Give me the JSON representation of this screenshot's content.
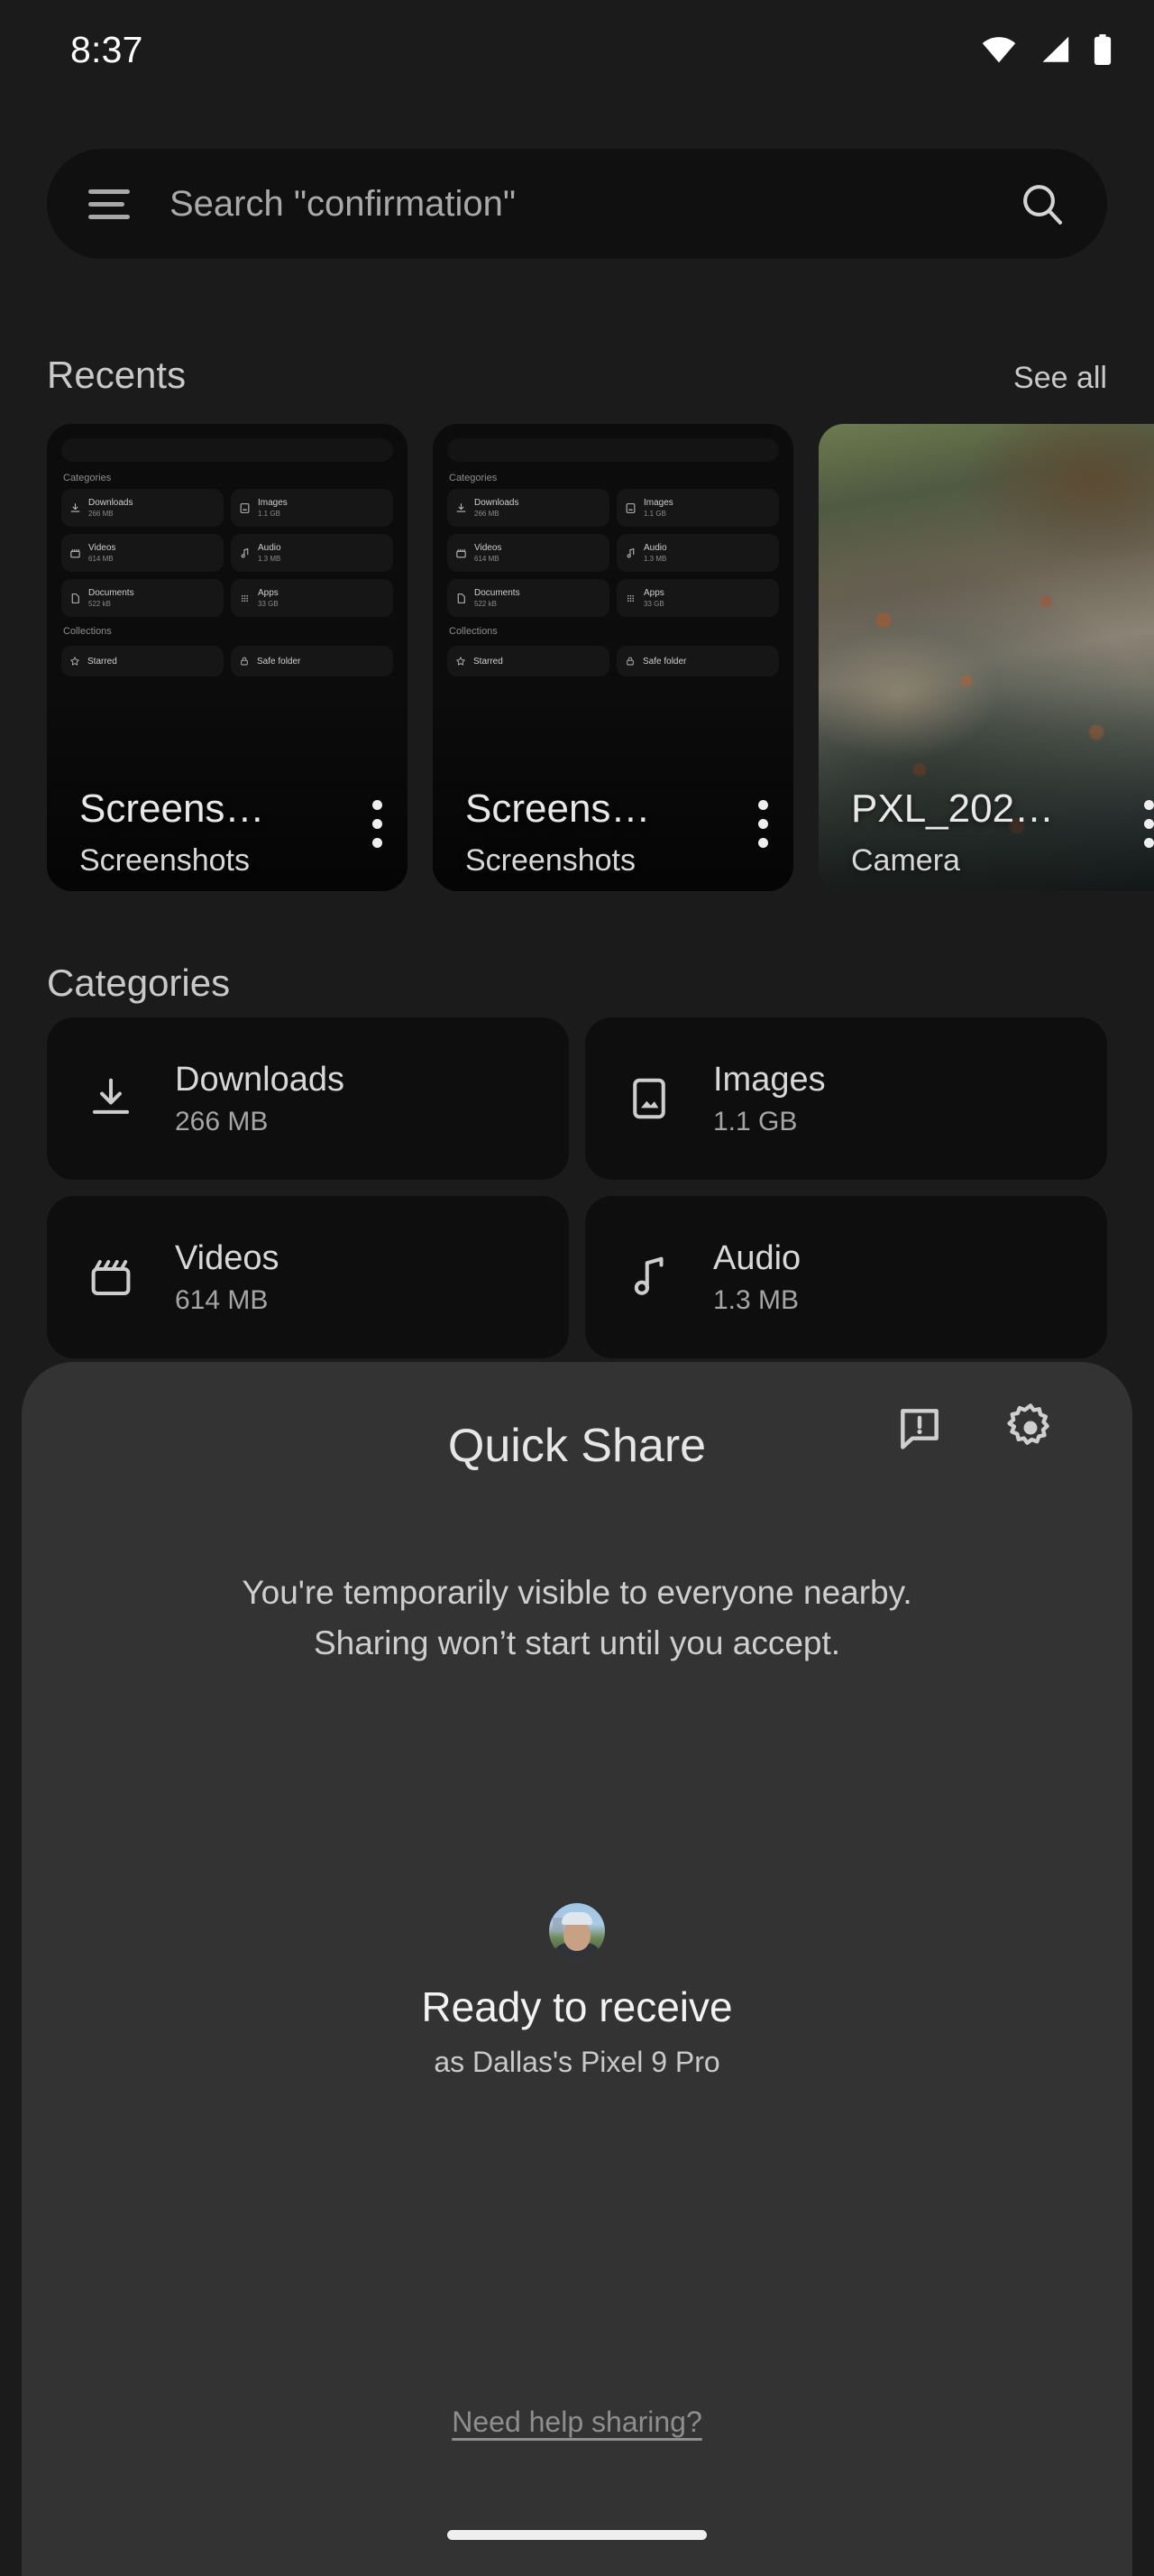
{
  "status_bar": {
    "time": "8:37",
    "icons": [
      "wifi-icon",
      "cellular-signal-icon",
      "battery-icon"
    ]
  },
  "search": {
    "placeholder": "Search \"confirmation\"",
    "menu_icon": "hamburger-menu-icon",
    "search_icon": "search-icon"
  },
  "recents": {
    "title": "Recents",
    "see_all": "See all",
    "cards": [
      {
        "name": "Screens…",
        "subtitle": "Screenshots",
        "kind": "nested-screenshot",
        "menu": "more-options-icon"
      },
      {
        "name": "Screens…",
        "subtitle": "Screenshots",
        "kind": "nested-screenshot",
        "menu": "more-options-icon"
      },
      {
        "name": "PXL_202…",
        "subtitle": "Camera",
        "kind": "photo-creek",
        "menu": "more-options-icon"
      }
    ]
  },
  "mini_screenshot": {
    "categories_label": "Categories",
    "collections_label": "Collections",
    "tiles": [
      {
        "label": "Downloads",
        "size": "266 MB",
        "icon": "download-icon"
      },
      {
        "label": "Images",
        "size": "1.1 GB",
        "icon": "image-icon"
      },
      {
        "label": "Videos",
        "size": "614 MB",
        "icon": "video-icon"
      },
      {
        "label": "Audio",
        "size": "1.3 MB",
        "icon": "audio-icon"
      },
      {
        "label": "Documents",
        "size": "522 kB",
        "icon": "document-icon"
      },
      {
        "label": "Apps",
        "size": "33 GB",
        "icon": "apps-grid-icon"
      }
    ],
    "collections": [
      {
        "label": "Starred",
        "icon": "star-icon"
      },
      {
        "label": "Safe folder",
        "icon": "lock-icon"
      }
    ]
  },
  "categories": {
    "title": "Categories",
    "tiles": [
      {
        "label": "Downloads",
        "size": "266 MB",
        "icon": "download-icon"
      },
      {
        "label": "Images",
        "size": "1.1 GB",
        "icon": "image-icon"
      },
      {
        "label": "Videos",
        "size": "614 MB",
        "icon": "video-icon"
      },
      {
        "label": "Audio",
        "size": "1.3 MB",
        "icon": "audio-icon"
      }
    ]
  },
  "quick_share": {
    "title": "Quick Share",
    "feedback_icon": "feedback-icon",
    "settings_icon": "gear-icon",
    "description_line1": "You're temporarily visible to everyone nearby.",
    "description_line2": "Sharing won’t start until you accept.",
    "avatar": "user-avatar",
    "status": "Ready to receive",
    "device": "as Dallas's Pixel 9 Pro",
    "help_link": "Need help sharing?"
  },
  "colors": {
    "page_background": "#1b1b1b",
    "search_background": "#101010",
    "tile_background": "#0e0e0e",
    "sheet_background": "#333333",
    "primary_text": "#e6e6e6",
    "secondary_text": "#a9a9a9"
  },
  "system": {
    "home_indicator": "home-indicator"
  }
}
